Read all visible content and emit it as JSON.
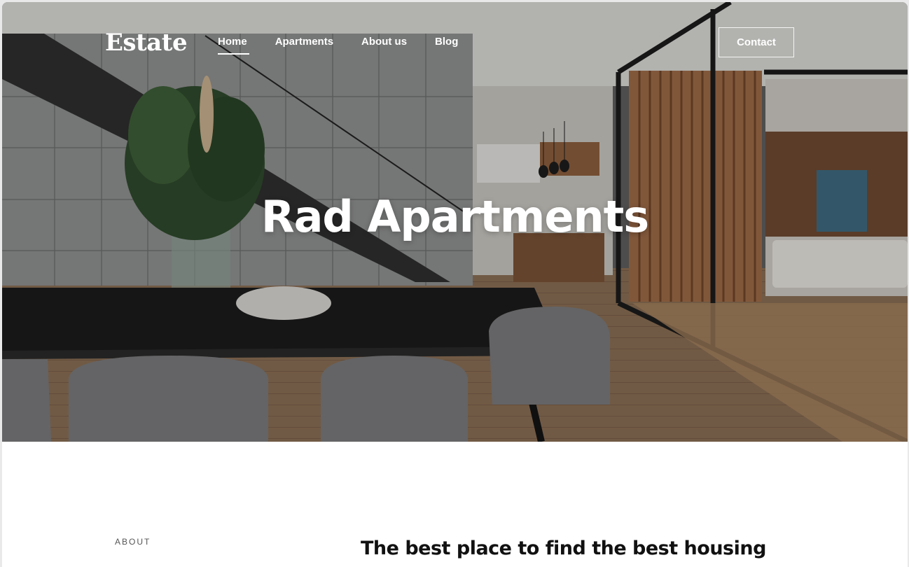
{
  "brand": {
    "logo": "Estate"
  },
  "nav": {
    "items": [
      {
        "label": "Home",
        "active": true
      },
      {
        "label": "Apartments",
        "active": false
      },
      {
        "label": "About us",
        "active": false
      },
      {
        "label": "Blog",
        "active": false
      }
    ],
    "contact_label": "Contact"
  },
  "hero": {
    "title": "Rad Apartments",
    "image": "interior-photo"
  },
  "about": {
    "label": "ABOUT",
    "heading": "The best place to find the best housing"
  },
  "colors": {
    "text_on_dark": "#ffffff",
    "heading": "#111111",
    "label": "#555555"
  }
}
